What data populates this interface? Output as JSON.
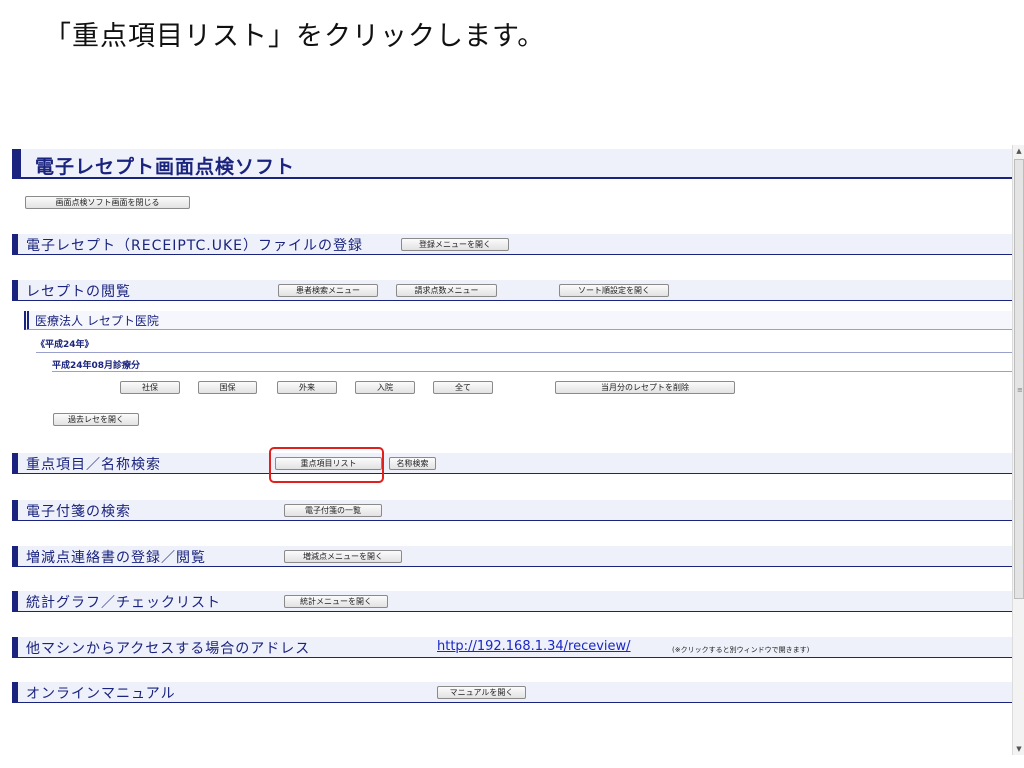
{
  "instruction": "「重点項目リスト」をクリックします。",
  "app": {
    "title": "電子レセプト画面点検ソフト",
    "close_button": "画面点検ソフト画面を閉じる"
  },
  "sections": {
    "register": {
      "title": "電子レセプト（RECEIPTC.UKE）ファイルの登録",
      "button": "登録メニューを開く"
    },
    "browse": {
      "title": "レセプトの閲覧",
      "patient_search": "患者検索メニュー",
      "claim_points": "請求点数メニュー",
      "sort_settings": "ソート順設定を開く",
      "institution": "医療法人 レセプト医院",
      "year_label": "《平成24年》",
      "month_label": "平成24年08月診療分",
      "buttons": {
        "shaho": "社保",
        "kokuho": "国保",
        "outpatient": "外来",
        "inpatient": "入院",
        "all": "全て",
        "delete_month": "当月分のレセプトを削除"
      },
      "past": "過去レセを開く"
    },
    "priority": {
      "title": "重点項目／名称検索",
      "list_button": "重点項目リスト",
      "name_search": "名称検索"
    },
    "tags": {
      "title": "電子付箋の検索",
      "button": "電子付箋の一覧"
    },
    "adjust": {
      "title": "増減点連絡書の登録／閲覧",
      "button": "増減点メニューを開く"
    },
    "stats": {
      "title": "統計グラフ／チェックリスト",
      "button": "統計メニューを開く"
    },
    "address": {
      "title": "他マシンからアクセスする場合のアドレス",
      "url": "http://192.168.1.34/receview/",
      "note": "(※クリックすると別ウィンドウで開きます)"
    },
    "manual": {
      "title": "オンラインマニュアル",
      "button": "マニュアルを開く"
    }
  },
  "scrollbar": {
    "up": "▲",
    "down": "▼",
    "mid": "≡"
  },
  "colors": {
    "accent": "#1a237e",
    "highlight": "#e0201c",
    "link": "#1a27c6"
  }
}
